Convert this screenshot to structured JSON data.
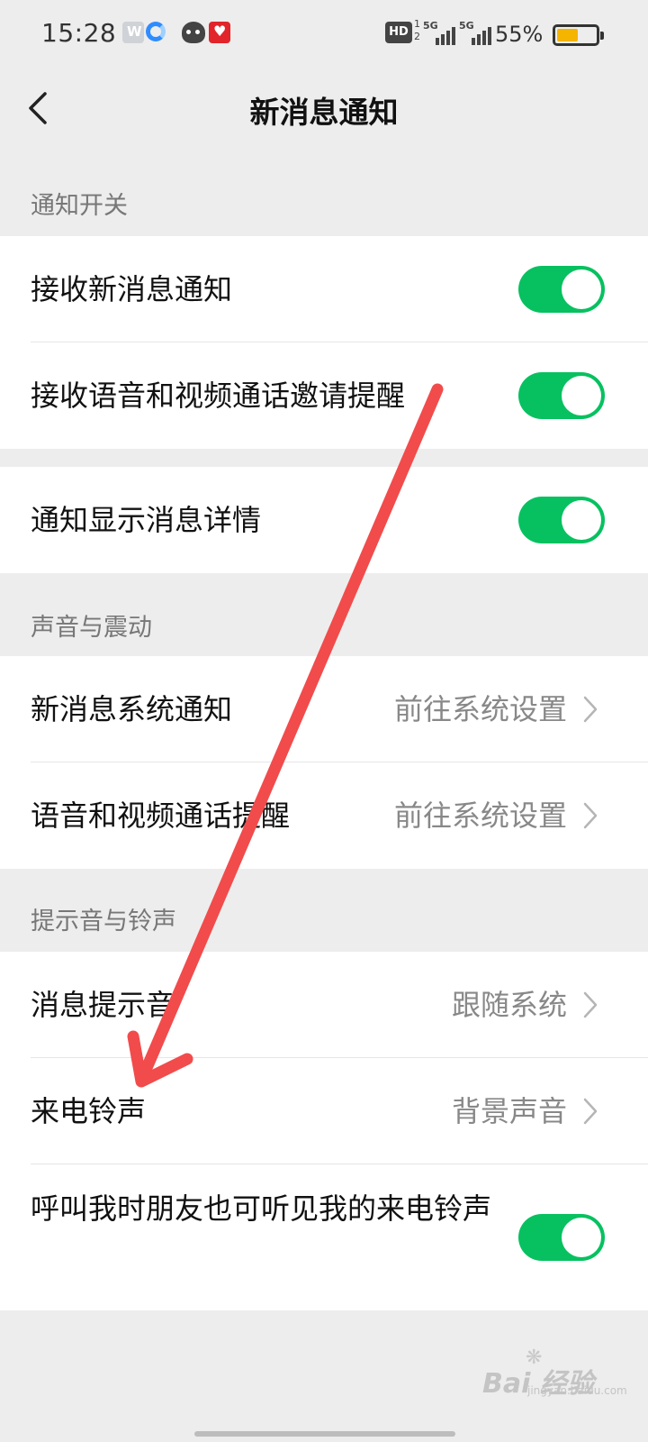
{
  "status_bar": {
    "time": "15:28",
    "hd_label": "HD",
    "hd_sub_top": "1",
    "hd_sub_bottom": "2",
    "net1": "5G",
    "net2": "5G",
    "battery_pct": "55%",
    "battery_level": 0.55,
    "battery_color": "#f4b400"
  },
  "nav": {
    "back_icon": "chevron-left-icon",
    "title": "新消息通知"
  },
  "sections": {
    "notify": {
      "header": "通知开关"
    },
    "sound": {
      "header": "声音与震动"
    },
    "ringtone": {
      "header": "提示音与铃声"
    }
  },
  "rows": {
    "receive_new": {
      "label": "接收新消息通知",
      "on": true
    },
    "receive_call": {
      "label": "接收语音和视频通话邀请提醒",
      "on": true
    },
    "show_detail": {
      "label": "通知显示消息详情",
      "on": true
    },
    "sys_notify": {
      "label": "新消息系统通知",
      "value": "前往系统设置"
    },
    "call_remind": {
      "label": "语音和视频通话提醒",
      "value": "前往系统设置"
    },
    "msg_tone": {
      "label": "消息提示音",
      "value": "跟随系统"
    },
    "ringtone": {
      "label": "来电铃声",
      "value": "背景声音"
    },
    "friends_hear": {
      "label": "呼叫我时朋友也可听见我的来电铃声",
      "on": true
    }
  },
  "colors": {
    "toggle_on": "#07c160",
    "arrow": "#f24b4b",
    "background": "#ededed"
  },
  "watermark": {
    "text": "Bai 经验",
    "sub": "jingyan.baidu.com"
  }
}
